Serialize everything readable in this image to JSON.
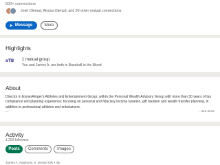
{
  "profile": {
    "connections": "500+ connections",
    "mutual_text": "Josh Olenud, Alyssa Olenud, and 26 other mutual connections",
    "message_label": "Message",
    "more_label": "More"
  },
  "highlights": {
    "title": "Highlights",
    "group_logo": "əTB",
    "group_name": "1 mutual group",
    "group_desc": "You and James A. are both in Baseball in the Blood"
  },
  "about": {
    "title": "About",
    "text": "Director in EisnerAmper's Athletes and Entertainment Group, within the Personal Wealth Advisory Group with more than 30 years of tax compliance and planning experience; focusing on personal and fiduciary income taxation, gift taxation and wealth transfer planning, in addition to professional athletes and entertainers.",
    "ellipsis": "...",
    "see_more": "...see more"
  },
  "activity": {
    "title": "Activity",
    "followers": "1,253 followers",
    "tabs": [
      "Posts",
      "Comments",
      "Images"
    ],
    "post_meta": "James A. Aatahoos, II. posted this • 3w"
  },
  "colors": {
    "primary": "#0a66c2",
    "active_pill": "#01754f",
    "background": "#ecebe7"
  }
}
